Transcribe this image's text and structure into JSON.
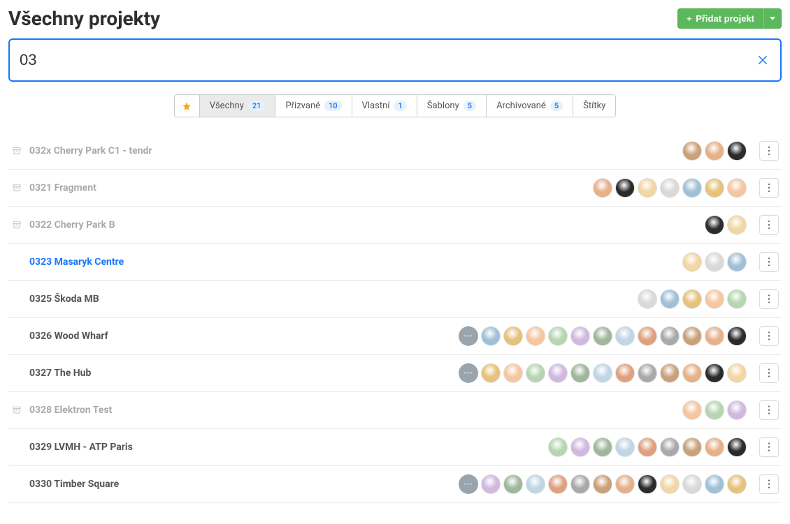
{
  "header": {
    "title": "Všechny projekty",
    "add_project_label": "Přidat projekt"
  },
  "search": {
    "value": "03"
  },
  "tabs": [
    {
      "id": "star",
      "label": "",
      "count": null,
      "active": false,
      "is_star": true
    },
    {
      "id": "vsechny",
      "label": "Všechny",
      "count": "21",
      "active": true
    },
    {
      "id": "prizvane",
      "label": "Přizvané",
      "count": "10",
      "active": false
    },
    {
      "id": "vlastni",
      "label": "Vlastní",
      "count": "1",
      "active": false
    },
    {
      "id": "sablony",
      "label": "Šablony",
      "count": "5",
      "active": false
    },
    {
      "id": "archivovane",
      "label": "Archivované",
      "count": "5",
      "active": false
    },
    {
      "id": "stitky",
      "label": "Štítky",
      "count": null,
      "active": false
    }
  ],
  "avatar_palette": [
    "#c9a17a",
    "#e6b089",
    "#2b2b2b",
    "#f2d6a3",
    "#d9d9d9",
    "#a0c0d8",
    "#e6c27a",
    "#f5c6a0",
    "#b5d6b0",
    "#d0b8e0",
    "#9fb79a",
    "#c0d6e4",
    "#e0a080",
    "#a9a9a9"
  ],
  "projects": [
    {
      "name": "032x Cherry Park C1 - tendr",
      "archived": true,
      "highlighted": false,
      "avatars": 3,
      "has_more": false
    },
    {
      "name": "0321 Fragment",
      "archived": true,
      "highlighted": false,
      "avatars": 7,
      "has_more": false
    },
    {
      "name": "0322 Cherry Park B",
      "archived": true,
      "highlighted": false,
      "avatars": 2,
      "has_more": false
    },
    {
      "name": "0323 Masaryk Centre",
      "archived": false,
      "highlighted": true,
      "avatars": 3,
      "has_more": false
    },
    {
      "name": "0325 Škoda MB",
      "archived": false,
      "highlighted": false,
      "avatars": 5,
      "has_more": false
    },
    {
      "name": "0326 Wood Wharf",
      "archived": false,
      "highlighted": false,
      "avatars": 12,
      "has_more": true
    },
    {
      "name": "0327 The Hub",
      "archived": false,
      "highlighted": false,
      "avatars": 12,
      "has_more": true
    },
    {
      "name": "0328 Elektron Test",
      "archived": true,
      "highlighted": false,
      "avatars": 3,
      "has_more": false
    },
    {
      "name": "0329 LVMH - ATP Paris",
      "archived": false,
      "highlighted": false,
      "avatars": 9,
      "has_more": false
    },
    {
      "name": "0330 Timber Square",
      "archived": false,
      "highlighted": false,
      "avatars": 12,
      "has_more": true
    }
  ]
}
